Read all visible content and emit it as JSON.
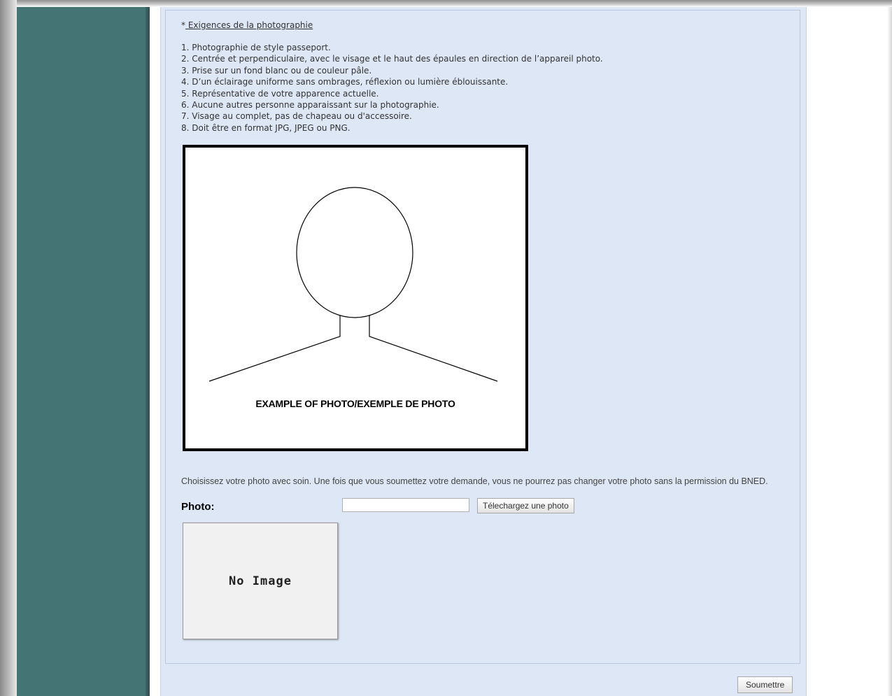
{
  "requirements": {
    "asterisk": "*",
    "title": " Exigences de la photographie ",
    "items": [
      "1. Photographie de style passeport.",
      "2. Centrée et perpendiculaire, avec le visage et le haut des épaules en direction de l’appareil photo.",
      "3. Prise sur un fond blanc ou de couleur pâle.",
      "4. D’un éclairage uniforme sans ombrages, réflexion ou lumière éblouissante.",
      "5. Représentative de votre apparence actuelle.",
      "6. Aucune autres personne apparaissant sur la photographie.",
      "7. Visage au complet, pas de chapeau ou d'accessoire.",
      "8. Doit être en format JPG, JPEG ou PNG."
    ]
  },
  "example": {
    "caption": "EXAMPLE OF PHOTO/EXEMPLE DE PHOTO"
  },
  "upload": {
    "instruction": "Choisissez votre photo avec soin. Une fois que vous soumettez votre demande, vous ne pourrez pas changer votre photo sans la permission du BNED.",
    "photo_label": "Photo:",
    "file_value": "",
    "upload_button": "Télechargez une photo",
    "preview_text": "No Image"
  },
  "submit_button": "Soumettre",
  "colors": {
    "sidebar": "#457474",
    "content_background": "#dde7f5"
  }
}
